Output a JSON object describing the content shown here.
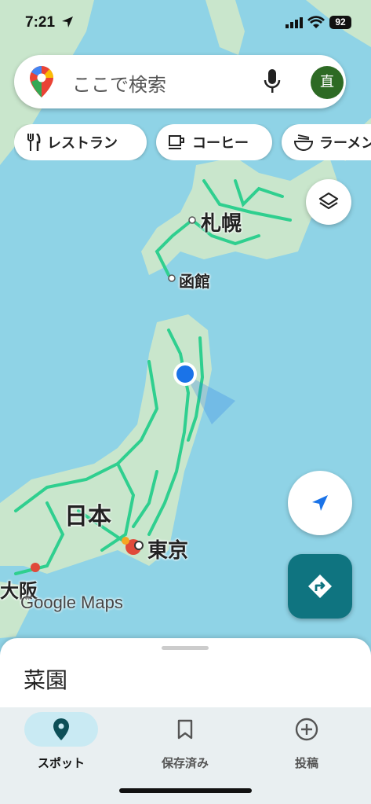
{
  "status": {
    "time": "7:21",
    "battery": "92"
  },
  "search": {
    "placeholder": "ここで検索",
    "avatar_initial": "直"
  },
  "chips": [
    {
      "label": "レストラン",
      "icon": "fork-knife-icon"
    },
    {
      "label": "コーヒー",
      "icon": "coffee-cup-icon"
    },
    {
      "label": "ラーメン",
      "icon": "ramen-bowl-icon"
    }
  ],
  "map": {
    "labels": {
      "sapporo": "札幌",
      "hakodate": "函館",
      "japan": "日本",
      "tokyo": "東京",
      "osaka": "大阪"
    },
    "attribution": "Google Maps"
  },
  "sheet": {
    "title": "菜園"
  },
  "nav": {
    "items": [
      {
        "label": "スポット",
        "icon": "location-pin-icon",
        "active": true
      },
      {
        "label": "保存済み",
        "icon": "bookmark-icon",
        "active": false
      },
      {
        "label": "投稿",
        "icon": "add-circle-icon",
        "active": false
      }
    ]
  },
  "colors": {
    "water": "#8fd3e6",
    "land": "#c9e6cc",
    "roads": "#2fcf8f",
    "accent": "#0f7480",
    "location": "#1a73e8"
  }
}
